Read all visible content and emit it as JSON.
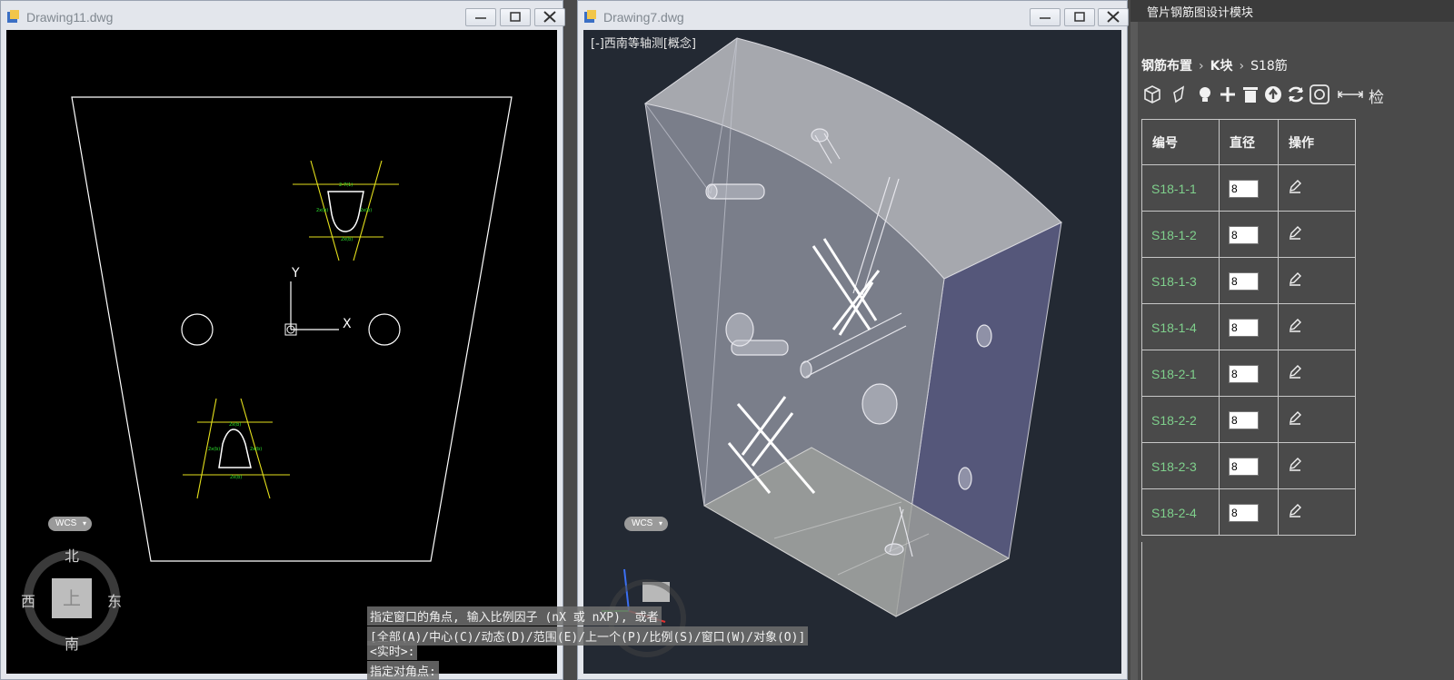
{
  "left_window": {
    "title": "Drawing11.dwg",
    "axis_y": "Y",
    "axis_x": "X",
    "wcs": "WCS",
    "compass": {
      "north": "北",
      "south": "南",
      "west": "西",
      "east": "东",
      "center": "上"
    }
  },
  "right_window": {
    "title": "Drawing7.dwg",
    "view_label": "[-]西南等轴测[概念]",
    "wcs": "WCS"
  },
  "command_line": {
    "line1": "指定窗口的角点, 输入比例因子 (nX 或 nXP), 或者",
    "line2": "[全部(A)/中心(C)/动态(D)/范围(E)/上一个(P)/比例(S)/窗口(W)/对象(O)]",
    "line3": "<实时>:",
    "prompt": "指定对角点:"
  },
  "panel": {
    "title": "管片钢筋图设计模块",
    "breadcrumb": [
      "钢筋布置",
      "K块",
      "S18筋"
    ],
    "toolbar_text": "检",
    "toolbar_icons": [
      "3d-box-icon",
      "shape-icon",
      "lightbulb-icon",
      "plus-icon",
      "trash-icon",
      "upload-icon",
      "refresh-icon",
      "settings-icon",
      "dimension-icon"
    ],
    "table": {
      "headers": [
        "编号",
        "直径",
        "操作"
      ],
      "rows": [
        {
          "id": "S18-1-1",
          "dia": "8"
        },
        {
          "id": "S18-1-2",
          "dia": "8"
        },
        {
          "id": "S18-1-3",
          "dia": "8"
        },
        {
          "id": "S18-1-4",
          "dia": "8"
        },
        {
          "id": "S18-2-1",
          "dia": "8"
        },
        {
          "id": "S18-2-2",
          "dia": "8"
        },
        {
          "id": "S18-2-3",
          "dia": "8"
        },
        {
          "id": "S18-2-4",
          "dia": "8"
        }
      ]
    }
  },
  "colors": {
    "panel_bg": "#4a4a4a",
    "id_green": "#7fd08c",
    "viewport_black": "#000000",
    "viewport_3d": "#232933"
  }
}
